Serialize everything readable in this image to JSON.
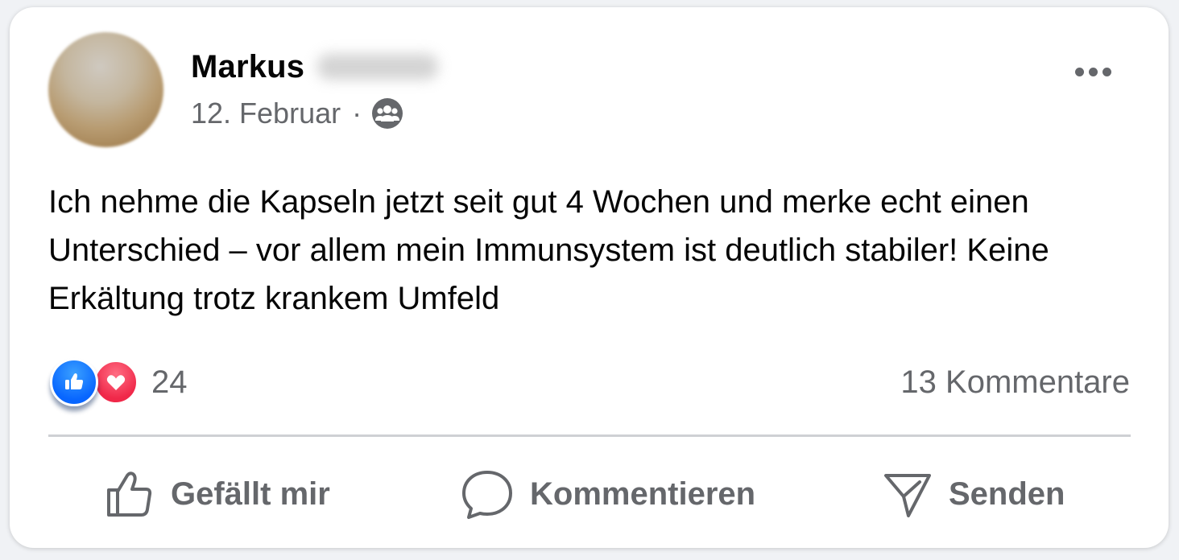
{
  "post": {
    "author_name": "Markus",
    "date": "12. Februar",
    "separator": "·",
    "audience_icon": "group-icon",
    "more_icon": "more-options-icon",
    "text": "Ich nehme die Kapseln jetzt seit gut 4 Wochen und merke echt einen Unterschied – vor allem mein Immunsystem ist deutlich stabiler! Keine Erkältung trotz krankem Umfeld"
  },
  "engagement": {
    "reaction_types": [
      "like-icon",
      "love-icon"
    ],
    "reaction_count": "24",
    "comments_label": "13 Kommentare"
  },
  "actions": {
    "like_label": "Gefällt mir",
    "comment_label": "Kommentieren",
    "share_label": "Senden"
  },
  "colors": {
    "text_primary": "#050505",
    "text_secondary": "#65676b",
    "like_blue": "#0866ff",
    "love_red": "#f02849",
    "divider": "#ced0d4"
  }
}
